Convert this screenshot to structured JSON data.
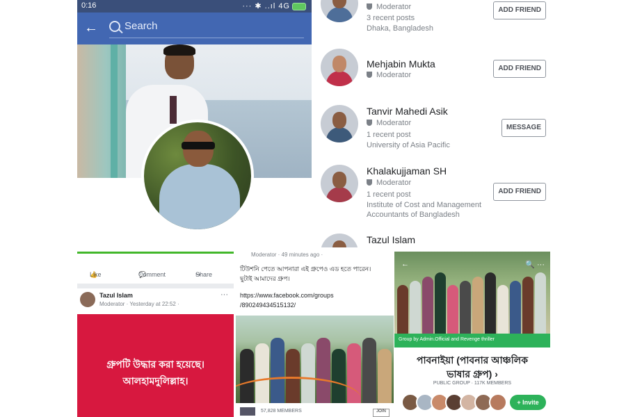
{
  "profile_screen": {
    "status_time": "0:16",
    "status_icons": "··· ✱ ..ıl 4G",
    "back_label": "←",
    "search_placeholder": "Search"
  },
  "members_screen": {
    "members": [
      {
        "name": "",
        "role": "Moderator",
        "posts": "3 recent posts",
        "location": "Dhaka, Bangladesh",
        "button": "ADD FRIEND"
      },
      {
        "name": "Mehjabin Mukta",
        "role": "Moderator",
        "posts": "",
        "location": "",
        "button": "ADD FRIEND"
      },
      {
        "name": "Tanvir Mahedi Asik",
        "role": "Moderator",
        "posts": "1 recent post",
        "location": "University of Asia Pacific",
        "button": "MESSAGE"
      },
      {
        "name": "Khalakujjaman SH",
        "role": "Moderator",
        "posts": "1 recent post",
        "location": "Institute of Cost and Management Accountants of Bangladesh",
        "button": "ADD FRIEND"
      },
      {
        "name": "Tazul Islam",
        "role": "",
        "posts": "",
        "location": "",
        "button": ""
      }
    ]
  },
  "post_left": {
    "like": "Like",
    "comment": "Comment",
    "share": "Share",
    "author": "Tazul Islam",
    "meta": "Moderator · Yesterday at 22:52 ·",
    "more": "···",
    "message_line1": "গ্রুপটি উদ্ধার করা হয়েছে।",
    "message_line2": "আলহামদুলিল্লাহ।"
  },
  "post_middle": {
    "meta": "Moderator · 49 minutes ago ·",
    "text_line1": "টিউশনি পেতে আপনারা এই গ্রুপেও এড হতে পারেন।",
    "text_line2": "ছুটাই আমাদের গ্রুপ।",
    "link_line1": "https://www.facebook.com/groups",
    "link_line2": "/890249434515132/",
    "members": "57,828 MEMBERS",
    "join": "JOIN"
  },
  "group_right": {
    "banner": "Group by Admin.Official and Revenge thriller",
    "name_line1": "পাবনাইয়া (পাবনার আঞ্চলিক",
    "name_line2": "ভাষার গ্রুপ) ›",
    "subtitle": "PUBLIC GROUP · 117K MEMBERS",
    "invite": "+ Invite"
  },
  "colors": {
    "facebook_blue": "#4267b2",
    "red_post": "#d7183f",
    "group_green": "#2db25a",
    "orange_arc": "#e8792a"
  },
  "icons": [
    "back-arrow-icon",
    "search-icon",
    "shield-icon",
    "like-icon",
    "comment-icon",
    "share-icon",
    "more-icon"
  ]
}
